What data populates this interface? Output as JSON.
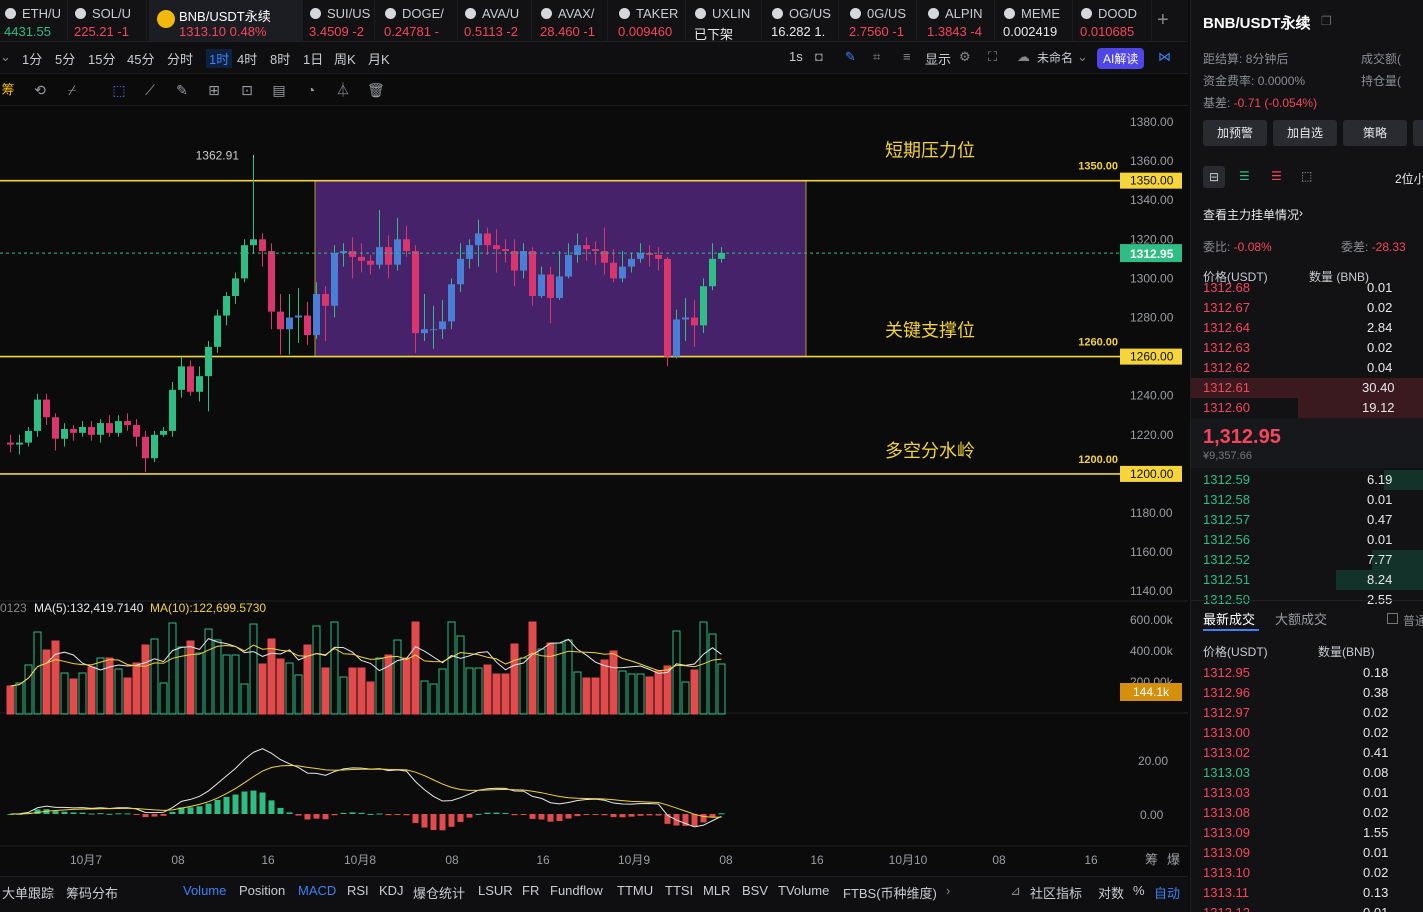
{
  "tabs": [
    {
      "name": "ETH/U",
      "price": "4431.55",
      "change": "",
      "color": "up",
      "left": 0,
      "w": 68
    },
    {
      "name": "SOL/U",
      "price": "225.21",
      "change": "-1",
      "color": "dn",
      "left": 70,
      "w": 77
    },
    {
      "name": "BNB/USDT永续",
      "price": "1313.10",
      "change": "0.48%",
      "color": "dn",
      "left": 149,
      "w": 154,
      "active": true
    },
    {
      "name": "SUI/US",
      "price": "3.4509",
      "change": "-2",
      "color": "dn",
      "left": 305,
      "w": 70
    },
    {
      "name": "DOGE/",
      "price": "0.24781",
      "change": "-",
      "color": "dn",
      "left": 380,
      "w": 78
    },
    {
      "name": "AVA/U",
      "price": "0.5113",
      "change": "-2",
      "color": "dn",
      "left": 460,
      "w": 72
    },
    {
      "name": "AVAX/",
      "price": "28.460",
      "change": "-1",
      "color": "dn",
      "left": 536,
      "w": 72
    },
    {
      "name": "TAKER",
      "price": "0.009460",
      "change": "",
      "color": "dn",
      "left": 614,
      "w": 72
    },
    {
      "name": "UXLIN",
      "price": "已下架",
      "change": "",
      "color": "wh",
      "left": 690,
      "w": 72
    },
    {
      "name": "OG/US",
      "price": "16.282",
      "change": "1.",
      "color": "wh",
      "left": 767,
      "w": 72
    },
    {
      "name": "0G/US",
      "price": "2.7560",
      "change": "-1",
      "color": "dn",
      "left": 845,
      "w": 72
    },
    {
      "name": "ALPIN",
      "price": "1.3843",
      "change": "-4",
      "color": "dn",
      "left": 923,
      "w": 72
    },
    {
      "name": "MEME",
      "price": "0.002419",
      "change": "",
      "color": "wh",
      "left": 999,
      "w": 74
    },
    {
      "name": "DOOD",
      "price": "0.010685",
      "change": "",
      "color": "dn",
      "left": 1076,
      "w": 76
    }
  ],
  "timeframes": [
    "1分",
    "5分",
    "15分",
    "45分",
    "分时",
    "1时",
    "4时",
    "8时",
    "1日",
    "周K",
    "月K"
  ],
  "selected_tf": "1时",
  "toolbar_right": {
    "interval": "1s",
    "display": "显示",
    "layout": "未命名",
    "ai": "AI解读"
  },
  "chips_left": "筹",
  "chart": {
    "annotations": {
      "resist": "短期压力位",
      "support": "关键支撑位",
      "divide": "多空分水岭"
    },
    "levels": [
      "1350.00",
      "1260.00",
      "1200.00"
    ],
    "high_label": "1362.91",
    "current": "1312.95",
    "yticks": [
      "1380.00",
      "1360.00",
      "1340.00",
      "1320.00",
      "1300.00",
      "1280.00",
      "1260.00",
      "1240.00",
      "1220.00",
      "1200.00",
      "1180.00",
      "1160.00",
      "1140.00"
    ],
    "xlabels": [
      "10月7",
      "08",
      "16",
      "10月8",
      "08",
      "16",
      "10月9",
      "08",
      "16",
      "10月10",
      "08",
      "16"
    ],
    "corner": [
      "筹",
      "爆"
    ],
    "vol_legend": {
      "left": "0123",
      "ma5": "MA(5):132,419.7140",
      "ma10": "MA(10):122,699.5730"
    },
    "vol_ticks": [
      "600.00k",
      "400.00k",
      "200.00k"
    ],
    "vol_current": "144.1k",
    "macd_ticks": [
      "20.00",
      "0.00"
    ]
  },
  "chart_data": {
    "type": "candlestick",
    "candles": [
      [
        1216,
        1215,
        1220,
        1211
      ],
      [
        1215,
        1216,
        1220,
        1210
      ],
      [
        1216,
        1222,
        1224,
        1214
      ],
      [
        1222,
        1238,
        1241,
        1219
      ],
      [
        1238,
        1229,
        1241,
        1225
      ],
      [
        1229,
        1218,
        1231,
        1212
      ],
      [
        1218,
        1223,
        1226,
        1214
      ],
      [
        1223,
        1221,
        1225,
        1217
      ],
      [
        1221,
        1224,
        1227,
        1219
      ],
      [
        1224,
        1220,
        1227,
        1217
      ],
      [
        1220,
        1226,
        1228,
        1216
      ],
      [
        1226,
        1221,
        1230,
        1219
      ],
      [
        1221,
        1227,
        1230,
        1219
      ],
      [
        1227,
        1225,
        1231,
        1222
      ],
      [
        1225,
        1219,
        1228,
        1214
      ],
      [
        1219,
        1208,
        1222,
        1201
      ],
      [
        1208,
        1220,
        1222,
        1206
      ],
      [
        1220,
        1222,
        1224,
        1219
      ],
      [
        1222,
        1243,
        1247,
        1219
      ],
      [
        1243,
        1255,
        1260,
        1239
      ],
      [
        1255,
        1242,
        1258,
        1240
      ],
      [
        1242,
        1250,
        1255,
        1237
      ],
      [
        1250,
        1265,
        1268,
        1232
      ],
      [
        1265,
        1281,
        1284,
        1262
      ],
      [
        1281,
        1291,
        1293,
        1276
      ],
      [
        1291,
        1300,
        1303,
        1287
      ],
      [
        1300,
        1317,
        1320,
        1298
      ],
      [
        1317,
        1320,
        1363,
        1313
      ],
      [
        1320,
        1314,
        1323,
        1306
      ],
      [
        1314,
        1283,
        1318,
        1274
      ],
      [
        1283,
        1274,
        1292,
        1261
      ],
      [
        1274,
        1280,
        1292,
        1261
      ],
      [
        1280,
        1281,
        1295,
        1267
      ],
      [
        1281,
        1271,
        1288,
        1266
      ],
      [
        1271,
        1292,
        1298,
        1269
      ],
      [
        1292,
        1286,
        1296,
        1268
      ],
      [
        1286,
        1313,
        1317,
        1280
      ],
      [
        1313,
        1314,
        1318,
        1306
      ],
      [
        1314,
        1311,
        1321,
        1300
      ],
      [
        1311,
        1309,
        1318,
        1303
      ],
      [
        1309,
        1307,
        1312,
        1302
      ],
      [
        1307,
        1316,
        1335,
        1305
      ],
      [
        1316,
        1307,
        1322,
        1300
      ],
      [
        1307,
        1320,
        1331,
        1304
      ],
      [
        1320,
        1314,
        1327,
        1311
      ],
      [
        1314,
        1272,
        1317,
        1262
      ],
      [
        1272,
        1274,
        1292,
        1268
      ],
      [
        1274,
        1274,
        1286,
        1264
      ],
      [
        1274,
        1278,
        1289,
        1269
      ],
      [
        1278,
        1297,
        1300,
        1274
      ],
      [
        1297,
        1310,
        1318,
        1293
      ],
      [
        1310,
        1317,
        1320,
        1305
      ],
      [
        1317,
        1323,
        1330,
        1306
      ],
      [
        1323,
        1317,
        1326,
        1312
      ],
      [
        1317,
        1315,
        1325,
        1303
      ],
      [
        1315,
        1314,
        1320,
        1308
      ],
      [
        1314,
        1304,
        1320,
        1296
      ],
      [
        1304,
        1314,
        1318,
        1300
      ],
      [
        1314,
        1291,
        1316,
        1286
      ],
      [
        1291,
        1302,
        1306,
        1290
      ],
      [
        1302,
        1290,
        1306,
        1277
      ],
      [
        1290,
        1301,
        1314,
        1289
      ],
      [
        1301,
        1312,
        1318,
        1300
      ],
      [
        1312,
        1317,
        1323,
        1308
      ],
      [
        1317,
        1315,
        1321,
        1309
      ],
      [
        1315,
        1314,
        1319,
        1307
      ],
      [
        1314,
        1308,
        1326,
        1302
      ],
      [
        1308,
        1300,
        1315,
        1298
      ],
      [
        1300,
        1306,
        1314,
        1298
      ],
      [
        1306,
        1310,
        1313,
        1303
      ],
      [
        1310,
        1313,
        1318,
        1308
      ],
      [
        1313,
        1312,
        1317,
        1306
      ],
      [
        1312,
        1310,
        1316,
        1304
      ],
      [
        1310,
        1260,
        1311,
        1255
      ],
      [
        1260,
        1279,
        1284,
        1259
      ],
      [
        1279,
        1280,
        1290,
        1268
      ],
      [
        1280,
        1276,
        1289,
        1265
      ],
      [
        1276,
        1296,
        1300,
        1272
      ],
      [
        1296,
        1310,
        1318,
        1294
      ],
      [
        1310,
        1313,
        1316,
        1308
      ]
    ],
    "resistance": 1350,
    "support": 1260,
    "divide": 1200,
    "high": 1362.91,
    "last": 1312.95
  },
  "right": {
    "title": "BNB/USDT永续",
    "stats": {
      "l1": "距结算:",
      "v1": "8分钟后",
      "l2": "成交额(",
      "l3": "资金费率:",
      "v3": "0.0000%",
      "l4": "持仓量(",
      "l5": "基差:",
      "v5": "-0.71 (-0.054%)"
    },
    "buttons": [
      "加预警",
      "加自选",
      "策略"
    ],
    "depth_sel": "2位小",
    "main_link": "查看主力挂单情况",
    "ratio": {
      "l1": "委比:",
      "v1": "-0.08%",
      "l2": "委差:",
      "v2": "-28.33"
    },
    "ob_head": {
      "price": "价格(USDT)",
      "qty": "数量 (BNB)"
    },
    "asks": [
      [
        "1312.68",
        "0.01",
        0
      ],
      [
        "1312.67",
        "0.02",
        0
      ],
      [
        "1312.64",
        "2.84",
        0
      ],
      [
        "1312.63",
        "0.02",
        0
      ],
      [
        "1312.62",
        "0.04",
        0
      ],
      [
        "1312.61",
        "30.40",
        233
      ],
      [
        "1312.60",
        "19.12",
        126
      ]
    ],
    "last": "1,312.95",
    "last_cny": "¥9,357.66",
    "bids": [
      [
        "1312.59",
        "6.19",
        40
      ],
      [
        "1312.58",
        "0.01",
        0
      ],
      [
        "1312.57",
        "0.47",
        0
      ],
      [
        "1312.56",
        "0.01",
        0
      ],
      [
        "1312.52",
        "7.77",
        52
      ],
      [
        "1312.51",
        "8.24",
        88
      ],
      [
        "1312.50",
        "2.55",
        0
      ]
    ],
    "trades_tabs": [
      "最新成交",
      "大额成交"
    ],
    "trades_check": "普通",
    "trades_head": {
      "price": "价格(USDT)",
      "qty": "数量(BNB)"
    },
    "trades": [
      [
        "1312.95",
        "0.18",
        "dn"
      ],
      [
        "1312.96",
        "0.38",
        "dn"
      ],
      [
        "1312.97",
        "0.02",
        "dn"
      ],
      [
        "1313.00",
        "0.02",
        "dn"
      ],
      [
        "1313.02",
        "0.41",
        "dn"
      ],
      [
        "1313.03",
        "0.08",
        "up"
      ],
      [
        "1313.03",
        "0.01",
        "dn"
      ],
      [
        "1313.08",
        "0.02",
        "dn"
      ],
      [
        "1313.09",
        "1.55",
        "dn"
      ],
      [
        "1313.09",
        "0.01",
        "dn"
      ],
      [
        "1313.10",
        "0.02",
        "dn"
      ],
      [
        "1313.11",
        "0.13",
        "dn"
      ],
      [
        "1313.12",
        "0.01",
        "dn"
      ]
    ]
  },
  "bottom": {
    "items": [
      "大单跟踪",
      "筹码分布",
      "Volume",
      "Position",
      "MACD",
      "RSI",
      "KDJ",
      "爆仓统计",
      "LSUR",
      "FR",
      "Fundflow",
      "TTMU",
      "TTSI",
      "MLR",
      "BSV",
      "TVolume",
      "FTBS(币种维度)"
    ],
    "right": [
      "社区指标",
      "对数",
      "%",
      "自动"
    ]
  }
}
